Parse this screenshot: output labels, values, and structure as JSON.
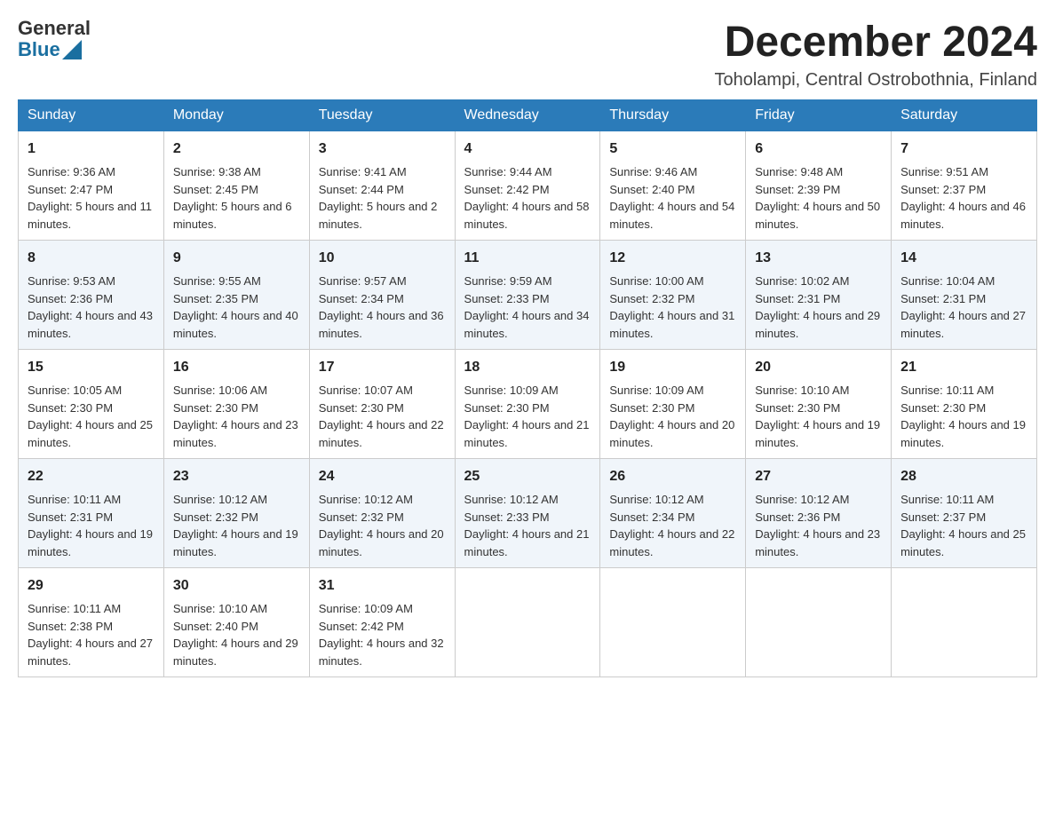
{
  "header": {
    "logo": {
      "text_general": "General",
      "text_blue": "Blue"
    },
    "month_year": "December 2024",
    "location": "Toholampi, Central Ostrobothnia, Finland"
  },
  "days_of_week": [
    "Sunday",
    "Monday",
    "Tuesday",
    "Wednesday",
    "Thursday",
    "Friday",
    "Saturday"
  ],
  "weeks": [
    [
      {
        "day": "1",
        "sunrise": "Sunrise: 9:36 AM",
        "sunset": "Sunset: 2:47 PM",
        "daylight": "Daylight: 5 hours and 11 minutes."
      },
      {
        "day": "2",
        "sunrise": "Sunrise: 9:38 AM",
        "sunset": "Sunset: 2:45 PM",
        "daylight": "Daylight: 5 hours and 6 minutes."
      },
      {
        "day": "3",
        "sunrise": "Sunrise: 9:41 AM",
        "sunset": "Sunset: 2:44 PM",
        "daylight": "Daylight: 5 hours and 2 minutes."
      },
      {
        "day": "4",
        "sunrise": "Sunrise: 9:44 AM",
        "sunset": "Sunset: 2:42 PM",
        "daylight": "Daylight: 4 hours and 58 minutes."
      },
      {
        "day": "5",
        "sunrise": "Sunrise: 9:46 AM",
        "sunset": "Sunset: 2:40 PM",
        "daylight": "Daylight: 4 hours and 54 minutes."
      },
      {
        "day": "6",
        "sunrise": "Sunrise: 9:48 AM",
        "sunset": "Sunset: 2:39 PM",
        "daylight": "Daylight: 4 hours and 50 minutes."
      },
      {
        "day": "7",
        "sunrise": "Sunrise: 9:51 AM",
        "sunset": "Sunset: 2:37 PM",
        "daylight": "Daylight: 4 hours and 46 minutes."
      }
    ],
    [
      {
        "day": "8",
        "sunrise": "Sunrise: 9:53 AM",
        "sunset": "Sunset: 2:36 PM",
        "daylight": "Daylight: 4 hours and 43 minutes."
      },
      {
        "day": "9",
        "sunrise": "Sunrise: 9:55 AM",
        "sunset": "Sunset: 2:35 PM",
        "daylight": "Daylight: 4 hours and 40 minutes."
      },
      {
        "day": "10",
        "sunrise": "Sunrise: 9:57 AM",
        "sunset": "Sunset: 2:34 PM",
        "daylight": "Daylight: 4 hours and 36 minutes."
      },
      {
        "day": "11",
        "sunrise": "Sunrise: 9:59 AM",
        "sunset": "Sunset: 2:33 PM",
        "daylight": "Daylight: 4 hours and 34 minutes."
      },
      {
        "day": "12",
        "sunrise": "Sunrise: 10:00 AM",
        "sunset": "Sunset: 2:32 PM",
        "daylight": "Daylight: 4 hours and 31 minutes."
      },
      {
        "day": "13",
        "sunrise": "Sunrise: 10:02 AM",
        "sunset": "Sunset: 2:31 PM",
        "daylight": "Daylight: 4 hours and 29 minutes."
      },
      {
        "day": "14",
        "sunrise": "Sunrise: 10:04 AM",
        "sunset": "Sunset: 2:31 PM",
        "daylight": "Daylight: 4 hours and 27 minutes."
      }
    ],
    [
      {
        "day": "15",
        "sunrise": "Sunrise: 10:05 AM",
        "sunset": "Sunset: 2:30 PM",
        "daylight": "Daylight: 4 hours and 25 minutes."
      },
      {
        "day": "16",
        "sunrise": "Sunrise: 10:06 AM",
        "sunset": "Sunset: 2:30 PM",
        "daylight": "Daylight: 4 hours and 23 minutes."
      },
      {
        "day": "17",
        "sunrise": "Sunrise: 10:07 AM",
        "sunset": "Sunset: 2:30 PM",
        "daylight": "Daylight: 4 hours and 22 minutes."
      },
      {
        "day": "18",
        "sunrise": "Sunrise: 10:09 AM",
        "sunset": "Sunset: 2:30 PM",
        "daylight": "Daylight: 4 hours and 21 minutes."
      },
      {
        "day": "19",
        "sunrise": "Sunrise: 10:09 AM",
        "sunset": "Sunset: 2:30 PM",
        "daylight": "Daylight: 4 hours and 20 minutes."
      },
      {
        "day": "20",
        "sunrise": "Sunrise: 10:10 AM",
        "sunset": "Sunset: 2:30 PM",
        "daylight": "Daylight: 4 hours and 19 minutes."
      },
      {
        "day": "21",
        "sunrise": "Sunrise: 10:11 AM",
        "sunset": "Sunset: 2:30 PM",
        "daylight": "Daylight: 4 hours and 19 minutes."
      }
    ],
    [
      {
        "day": "22",
        "sunrise": "Sunrise: 10:11 AM",
        "sunset": "Sunset: 2:31 PM",
        "daylight": "Daylight: 4 hours and 19 minutes."
      },
      {
        "day": "23",
        "sunrise": "Sunrise: 10:12 AM",
        "sunset": "Sunset: 2:32 PM",
        "daylight": "Daylight: 4 hours and 19 minutes."
      },
      {
        "day": "24",
        "sunrise": "Sunrise: 10:12 AM",
        "sunset": "Sunset: 2:32 PM",
        "daylight": "Daylight: 4 hours and 20 minutes."
      },
      {
        "day": "25",
        "sunrise": "Sunrise: 10:12 AM",
        "sunset": "Sunset: 2:33 PM",
        "daylight": "Daylight: 4 hours and 21 minutes."
      },
      {
        "day": "26",
        "sunrise": "Sunrise: 10:12 AM",
        "sunset": "Sunset: 2:34 PM",
        "daylight": "Daylight: 4 hours and 22 minutes."
      },
      {
        "day": "27",
        "sunrise": "Sunrise: 10:12 AM",
        "sunset": "Sunset: 2:36 PM",
        "daylight": "Daylight: 4 hours and 23 minutes."
      },
      {
        "day": "28",
        "sunrise": "Sunrise: 10:11 AM",
        "sunset": "Sunset: 2:37 PM",
        "daylight": "Daylight: 4 hours and 25 minutes."
      }
    ],
    [
      {
        "day": "29",
        "sunrise": "Sunrise: 10:11 AM",
        "sunset": "Sunset: 2:38 PM",
        "daylight": "Daylight: 4 hours and 27 minutes."
      },
      {
        "day": "30",
        "sunrise": "Sunrise: 10:10 AM",
        "sunset": "Sunset: 2:40 PM",
        "daylight": "Daylight: 4 hours and 29 minutes."
      },
      {
        "day": "31",
        "sunrise": "Sunrise: 10:09 AM",
        "sunset": "Sunset: 2:42 PM",
        "daylight": "Daylight: 4 hours and 32 minutes."
      },
      null,
      null,
      null,
      null
    ]
  ]
}
